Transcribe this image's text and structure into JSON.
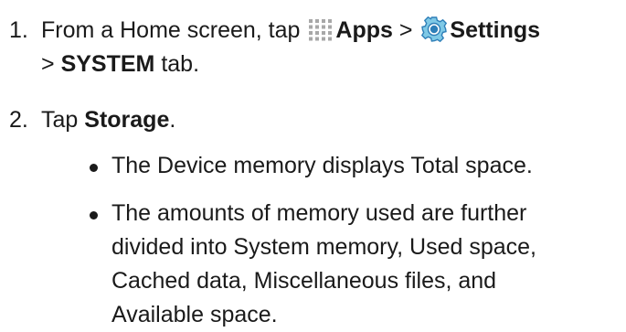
{
  "steps": [
    {
      "number": "1.",
      "line1": {
        "prefix": "From a Home screen, tap",
        "apps_label": "Apps",
        "separator": ">",
        "settings_label": "Settings"
      },
      "line2": {
        "prefix": ">",
        "tab_label": "SYSTEM",
        "suffix": "tab."
      }
    },
    {
      "number": "2.",
      "prefix": "Tap",
      "target_label": "Storage",
      "suffix": "."
    }
  ],
  "bullets": [
    {
      "lines": [
        "The Device memory displays Total space."
      ]
    },
    {
      "lines": [
        "The amounts of memory used are further",
        "divided into System memory, Used space,",
        "Cached data, Miscellaneous files, and",
        "Available space."
      ]
    }
  ],
  "icons": {
    "apps": "apps-grid-icon",
    "settings": "settings-gear-icon"
  },
  "colors": {
    "text": "#1a1a1a",
    "apps_icon": "#a8a8a8",
    "settings_icon_outer": "#7fc9e6",
    "settings_icon_inner": "#2e7fb8"
  }
}
